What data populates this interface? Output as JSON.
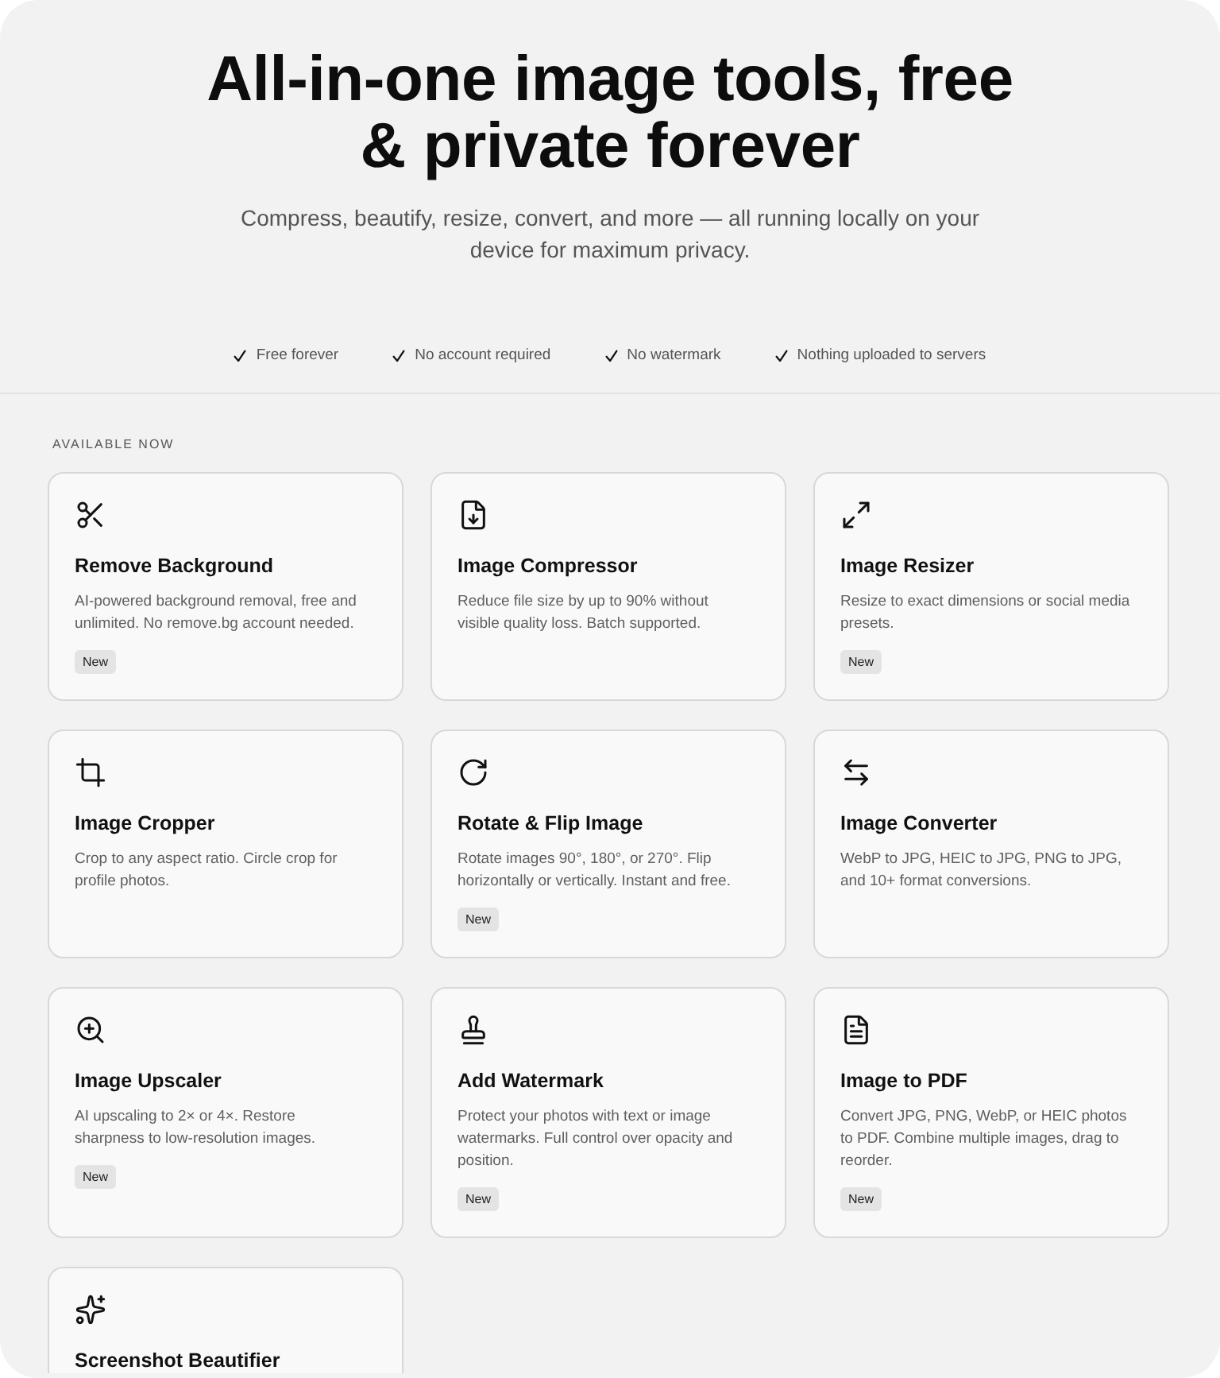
{
  "hero": {
    "title": "All-in-one image tools, free & private forever",
    "subtitle": "Compress, beautify, resize, convert, and more — all running locally on your device for maximum privacy."
  },
  "features": [
    "Free forever",
    "No account required",
    "No watermark",
    "Nothing uploaded to servers"
  ],
  "section": {
    "heading": "AVAILABLE NOW"
  },
  "tools": [
    {
      "title": "Remove Background",
      "description": "AI-powered background removal, free and unlimited. No remove.bg account needed.",
      "badge": "New"
    },
    {
      "title": "Image Compressor",
      "description": "Reduce file size by up to 90% without visible quality loss. Batch supported."
    },
    {
      "title": "Image Resizer",
      "description": "Resize to exact dimensions or social media presets.",
      "badge": "New"
    },
    {
      "title": "Image Cropper",
      "description": "Crop to any aspect ratio. Circle crop for profile photos."
    },
    {
      "title": "Rotate & Flip Image",
      "description": "Rotate images 90°, 180°, or 270°. Flip horizontally or vertically. Instant and free.",
      "badge": "New"
    },
    {
      "title": "Image Converter",
      "description": "WebP to JPG, HEIC to JPG, PNG to JPG, and 10+ format conversions."
    },
    {
      "title": "Image Upscaler",
      "description": "AI upscaling to 2× or 4×. Restore sharpness to low-resolution images.",
      "badge": "New"
    },
    {
      "title": "Add Watermark",
      "description": "Protect your photos with text or image watermarks. Full control over opacity and position.",
      "badge": "New"
    },
    {
      "title": "Image to PDF",
      "description": "Convert JPG, PNG, WebP, or HEIC photos to PDF. Combine multiple images, drag to reorder.",
      "badge": "New"
    },
    {
      "title": "Screenshot Beautifier"
    }
  ]
}
